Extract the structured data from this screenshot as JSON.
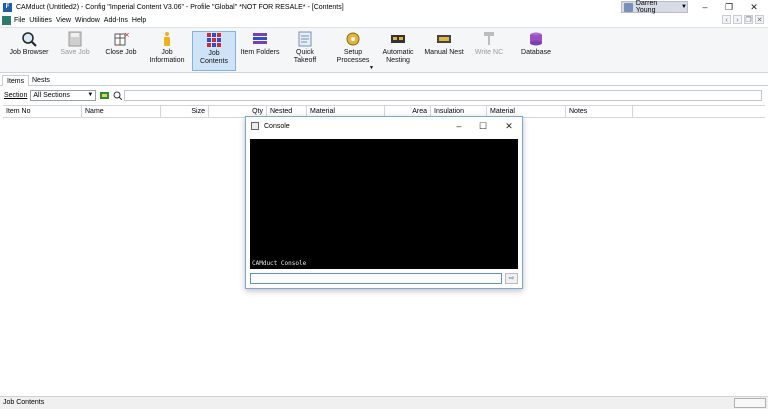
{
  "window": {
    "title": "CAMduct (Untitled2) - Config \"Imperial Content V3.06\" - Profile \"Global\" *NOT FOR RESALE* - [Contents]",
    "user": "Darren Young"
  },
  "menu": {
    "items": [
      "File",
      "Utilities",
      "View",
      "Window",
      "Add-Ins",
      "Help"
    ]
  },
  "ribbon": {
    "buttons": [
      {
        "label": "Job Browser"
      },
      {
        "label": "Save Job"
      },
      {
        "label": "Close Job"
      },
      {
        "label": "Job\nInformation"
      },
      {
        "label": "Job\nContents"
      },
      {
        "label": "Item Folders"
      },
      {
        "label": "Quick\nTakeoff"
      },
      {
        "label": "Setup\nProcesses"
      },
      {
        "label": "Automatic\nNesting"
      },
      {
        "label": "Manual Nest"
      },
      {
        "label": "Write NC"
      },
      {
        "label": "Database"
      }
    ]
  },
  "tabs": [
    "Items",
    "Nests"
  ],
  "filter": {
    "section_label": "Section",
    "section_value": "All Sections"
  },
  "grid": {
    "columns": [
      "Item No",
      "Name",
      "Size",
      "Qty",
      "Nested",
      "Material",
      "Area",
      "Insulation",
      "Material",
      "Notes"
    ]
  },
  "console": {
    "title": "Console",
    "text": "CAMduct Console"
  },
  "status": {
    "text": "Job Contents"
  }
}
